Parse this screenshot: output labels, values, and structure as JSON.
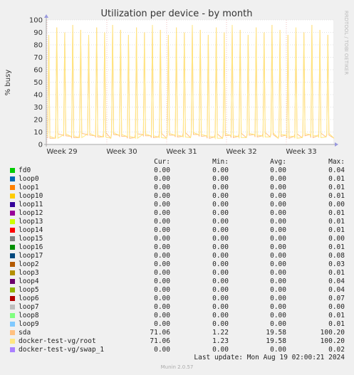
{
  "chart_data": {
    "type": "line",
    "title": "Utilization per device - by month",
    "ylabel": "% busy",
    "ylim": [
      0,
      100
    ],
    "yticks": [
      "0",
      "10",
      "20",
      "30",
      "40",
      "50",
      "60",
      "70",
      "80",
      "90",
      "100"
    ],
    "xticks": [
      "Week 29",
      "Week 30",
      "Week 31",
      "Week 32",
      "Week 33"
    ],
    "grid": true,
    "series": [
      {
        "name": "sda",
        "color": "#ffc080",
        "pattern": {
          "baseline": 5,
          "spike": 100,
          "spikes_per_week": 7
        }
      },
      {
        "name": "docker-test-vg/root",
        "color": "#ffe680",
        "pattern": {
          "baseline": 5,
          "spike": 100,
          "spikes_per_week": 7
        }
      }
    ]
  },
  "side_text": "RRDTOOL / TOBI OETIKER",
  "legend": {
    "headers": {
      "cur": "Cur:",
      "min": "Min:",
      "avg": "Avg:",
      "max": "Max:"
    },
    "rows": [
      {
        "name": "fd0",
        "color": "#00cc00",
        "cur": "0.00",
        "min": "0.00",
        "avg": "0.00",
        "max": "0.04"
      },
      {
        "name": "loop0",
        "color": "#0066b3",
        "cur": "0.00",
        "min": "0.00",
        "avg": "0.00",
        "max": "0.01"
      },
      {
        "name": "loop1",
        "color": "#ff8000",
        "cur": "0.00",
        "min": "0.00",
        "avg": "0.00",
        "max": "0.01"
      },
      {
        "name": "loop10",
        "color": "#ffcc00",
        "cur": "0.00",
        "min": "0.00",
        "avg": "0.00",
        "max": "0.01"
      },
      {
        "name": "loop11",
        "color": "#330099",
        "cur": "0.00",
        "min": "0.00",
        "avg": "0.00",
        "max": "0.00"
      },
      {
        "name": "loop12",
        "color": "#990099",
        "cur": "0.00",
        "min": "0.00",
        "avg": "0.00",
        "max": "0.01"
      },
      {
        "name": "loop13",
        "color": "#ccff00",
        "cur": "0.00",
        "min": "0.00",
        "avg": "0.00",
        "max": "0.01"
      },
      {
        "name": "loop14",
        "color": "#ff0000",
        "cur": "0.00",
        "min": "0.00",
        "avg": "0.00",
        "max": "0.01"
      },
      {
        "name": "loop15",
        "color": "#808080",
        "cur": "0.00",
        "min": "0.00",
        "avg": "0.00",
        "max": "0.00"
      },
      {
        "name": "loop16",
        "color": "#008f00",
        "cur": "0.00",
        "min": "0.00",
        "avg": "0.00",
        "max": "0.01"
      },
      {
        "name": "loop17",
        "color": "#00487d",
        "cur": "0.00",
        "min": "0.00",
        "avg": "0.00",
        "max": "0.08"
      },
      {
        "name": "loop2",
        "color": "#b35a00",
        "cur": "0.00",
        "min": "0.00",
        "avg": "0.00",
        "max": "0.03"
      },
      {
        "name": "loop3",
        "color": "#b38f00",
        "cur": "0.00",
        "min": "0.00",
        "avg": "0.00",
        "max": "0.01"
      },
      {
        "name": "loop4",
        "color": "#6b006b",
        "cur": "0.00",
        "min": "0.00",
        "avg": "0.00",
        "max": "0.04"
      },
      {
        "name": "loop5",
        "color": "#8fb300",
        "cur": "0.00",
        "min": "0.00",
        "avg": "0.00",
        "max": "0.04"
      },
      {
        "name": "loop6",
        "color": "#b30000",
        "cur": "0.00",
        "min": "0.00",
        "avg": "0.00",
        "max": "0.07"
      },
      {
        "name": "loop7",
        "color": "#bebebe",
        "cur": "0.00",
        "min": "0.00",
        "avg": "0.00",
        "max": "0.00"
      },
      {
        "name": "loop8",
        "color": "#80ff80",
        "cur": "0.00",
        "min": "0.00",
        "avg": "0.00",
        "max": "0.01"
      },
      {
        "name": "loop9",
        "color": "#80c9ff",
        "cur": "0.00",
        "min": "0.00",
        "avg": "0.00",
        "max": "0.01"
      },
      {
        "name": "sda",
        "color": "#ffc080",
        "cur": "71.06",
        "min": "1.22",
        "avg": "19.58",
        "max": "100.20"
      },
      {
        "name": "docker-test-vg/root",
        "color": "#ffe680",
        "cur": "71.06",
        "min": "1.23",
        "avg": "19.58",
        "max": "100.20"
      },
      {
        "name": "docker-test-vg/swap_1",
        "color": "#aa80ff",
        "cur": "0.00",
        "min": "0.00",
        "avg": "0.00",
        "max": "0.02"
      }
    ]
  },
  "last_update": "Last update: Mon Aug 19 02:00:21 2024",
  "footer": "Munin 2.0.57"
}
